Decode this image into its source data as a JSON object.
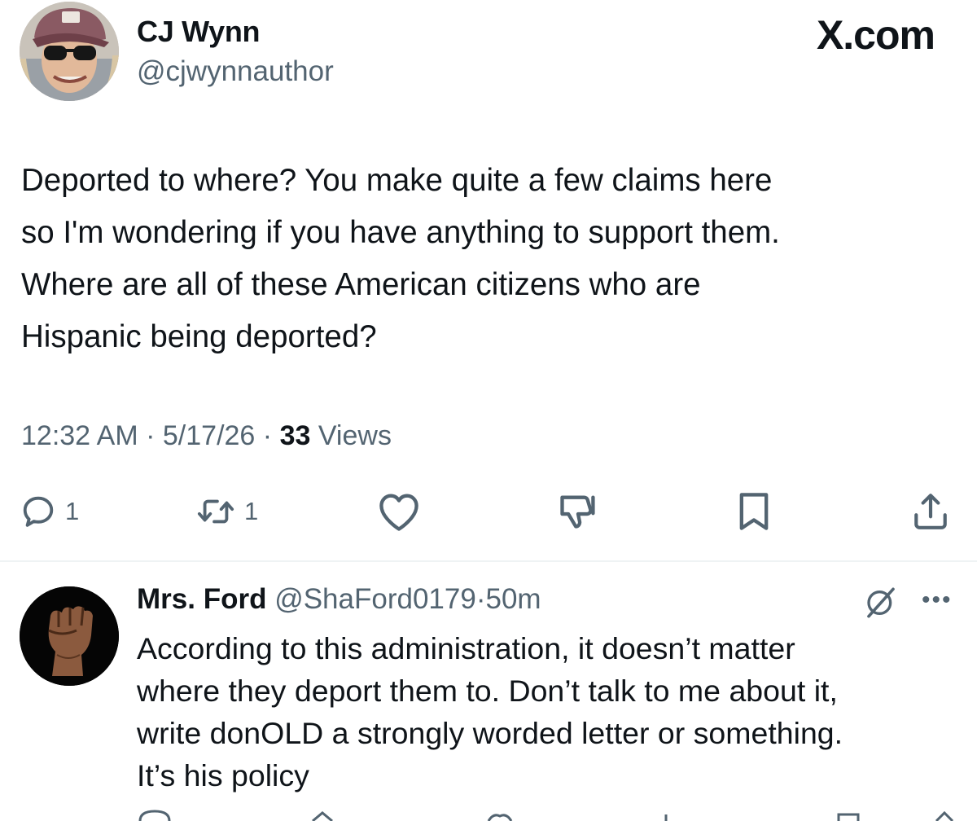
{
  "tweet": {
    "author_name": "CJ Wynn",
    "author_handle": "@cjwynnauthor",
    "brand": "X.com",
    "text": "Deported to where? You make quite a few claims here\nso I'm wondering if you have anything to support them.\nWhere are all of these American citizens who are\nHispanic being deported?",
    "time": "12:32 AM",
    "date": "5/17/26",
    "separator": "·",
    "views_count": "33",
    "views_label": "Views",
    "actions": {
      "reply_icon": "reply-icon",
      "reply_count": "1",
      "retweet_icon": "retweet-icon",
      "retweet_count": "1",
      "like_icon": "heart-icon",
      "dislike_icon": "thumbs-down-icon",
      "bookmark_icon": "bookmark-icon",
      "share_icon": "share-icon"
    }
  },
  "reply": {
    "author_name": "Mrs. Ford",
    "author_handle": "@ShaFord0179",
    "separator": "·",
    "time": "50m",
    "text": "According to this administration, it doesn’t matter\nwhere they deport them to. Don’t talk to me about it,\nwrite donOLD a strongly worded letter or something.\nIt’s his policy",
    "avatar": "raised-fist",
    "grok_icon": "grok-icon",
    "more_icon": "more-icon"
  },
  "colors": {
    "text_primary": "#0f1419",
    "text_secondary": "#536471",
    "divider": "#eff3f4",
    "background": "#ffffff"
  }
}
